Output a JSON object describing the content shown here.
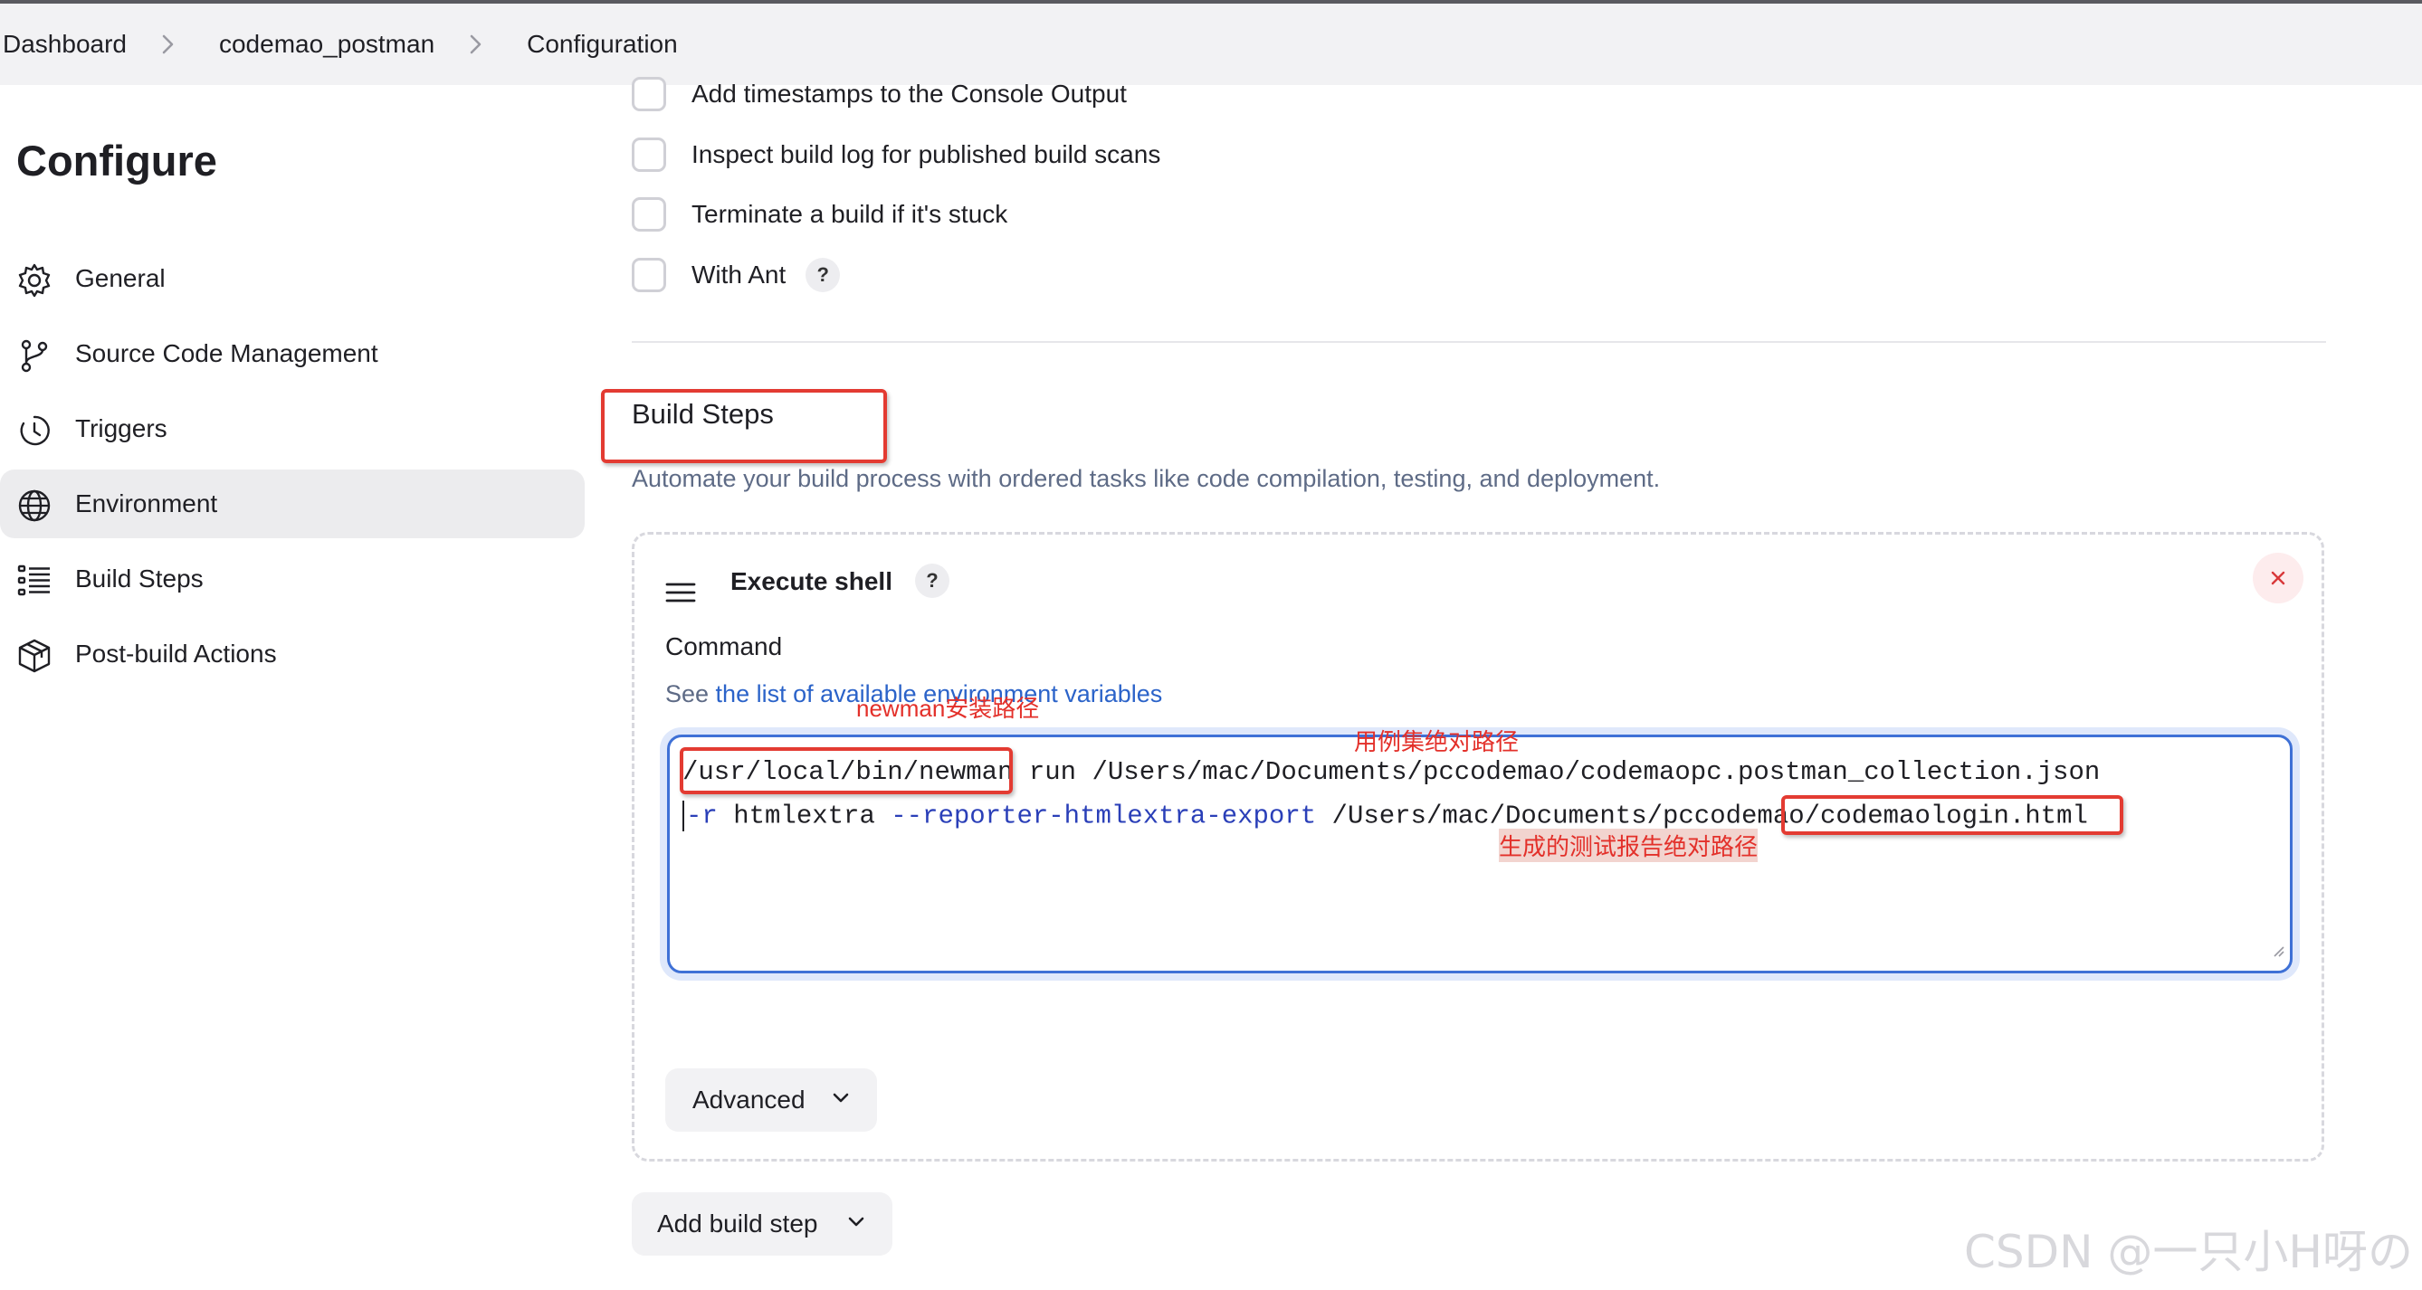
{
  "breadcrumb": {
    "items": [
      "Dashboard",
      "codemao_postman",
      "Configuration"
    ]
  },
  "page": {
    "title": "Configure"
  },
  "sidebar": {
    "items": [
      {
        "label": "General",
        "icon": "gear-icon"
      },
      {
        "label": "Source Code Management",
        "icon": "branch-icon"
      },
      {
        "label": "Triggers",
        "icon": "clock-icon"
      },
      {
        "label": "Environment",
        "icon": "globe-icon",
        "active": true
      },
      {
        "label": "Build Steps",
        "icon": "list-icon"
      },
      {
        "label": "Post-build Actions",
        "icon": "package-icon"
      }
    ]
  },
  "options": {
    "items": [
      {
        "label": "Add timestamps to the Console Output",
        "checked": false
      },
      {
        "label": "Inspect build log for published build scans",
        "checked": false
      },
      {
        "label": "Terminate a build if it's stuck",
        "checked": false
      },
      {
        "label": "With Ant",
        "checked": false,
        "help": "?"
      }
    ]
  },
  "build_steps": {
    "title": "Build Steps",
    "description": "Automate your build process with ordered tasks like code compilation, testing, and deployment.",
    "step": {
      "name": "Execute shell",
      "help": "?",
      "command_label": "Command",
      "see_prefix": "See ",
      "see_link": "the list of available environment variables",
      "command_line1_path": "/usr/local/bin/newman",
      "command_line1_rest": " run /Users/mac/Documents/pccodemao/codemaopc.postman_collection.json",
      "command_line2_flag": "-r",
      "command_line2_mid": " htmlextra ",
      "command_line2_opt": "--reporter-htmlextra-export",
      "command_line2_rest": " /Users/mac/Documents/pccodemao/codemaologin.html",
      "advanced_label": "Advanced"
    },
    "add_label": "Add build step"
  },
  "annotations": {
    "newman_path": "newman安装路径",
    "collection_path": "用例集绝对路径",
    "report_path": "生成的测试报告绝对路径"
  },
  "colors": {
    "annotation_red": "#e33b32",
    "link_blue": "#2b63c9",
    "focus_blue": "#3f71d6"
  },
  "watermark": "CSDN @一只小H呀の"
}
